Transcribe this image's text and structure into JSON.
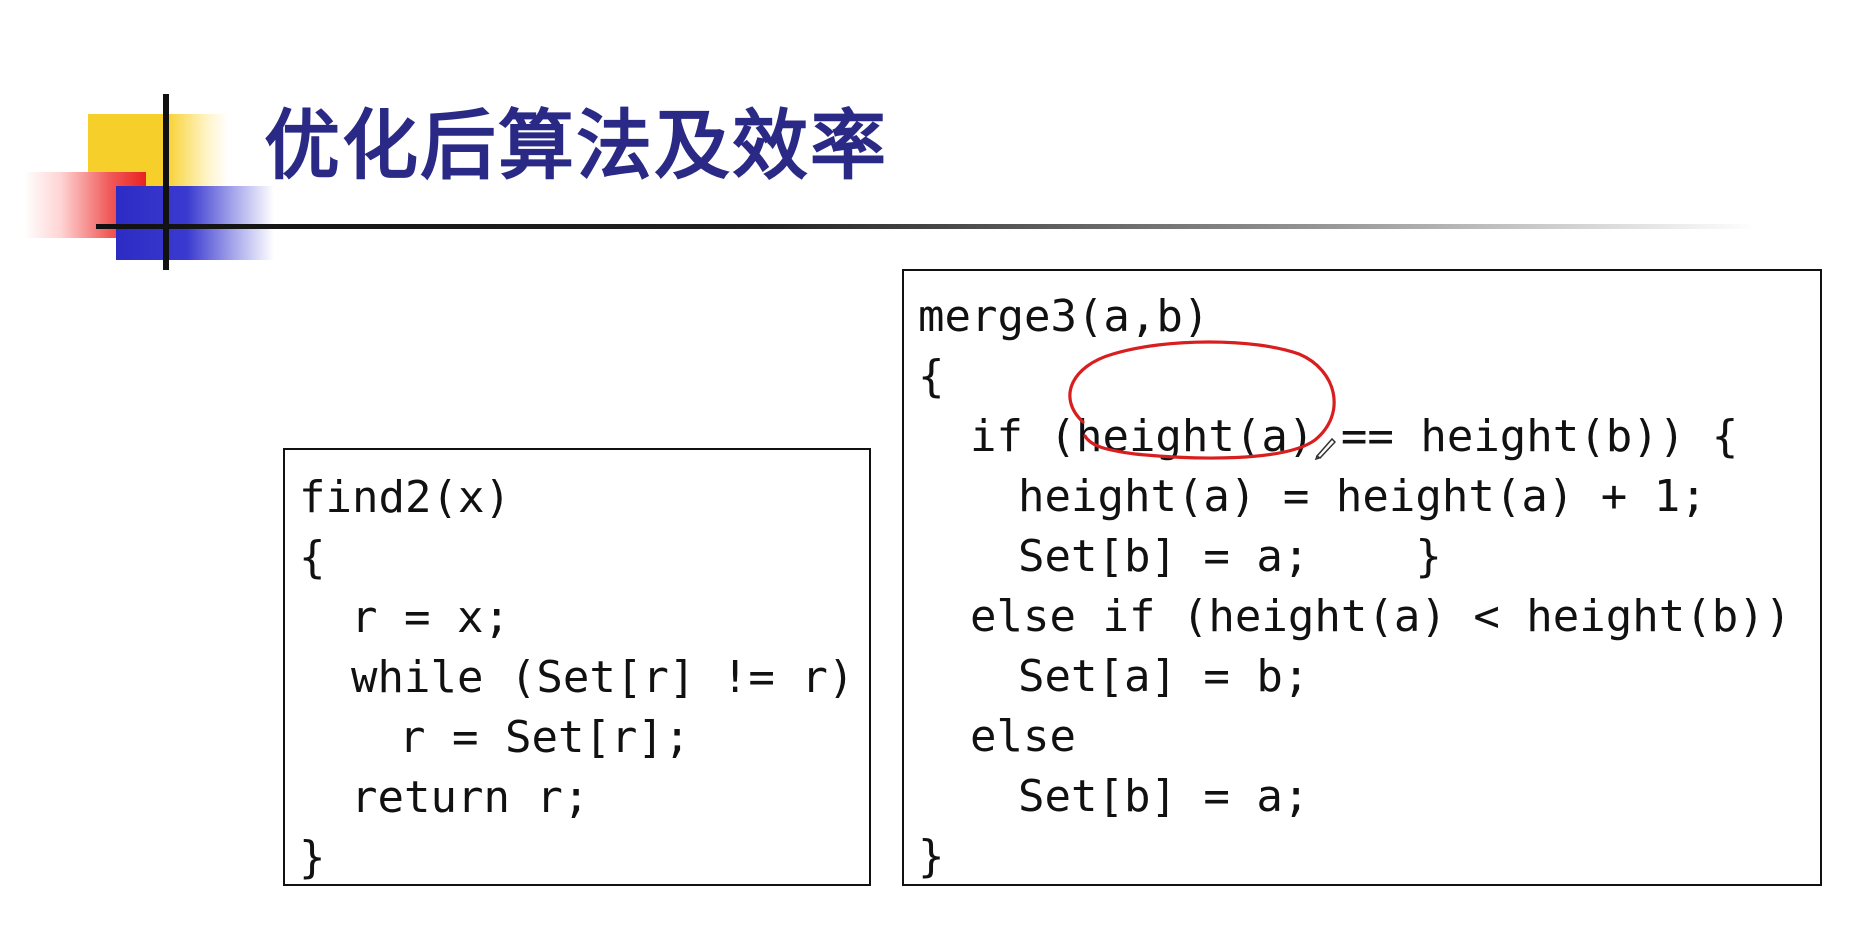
{
  "slide": {
    "title": "优化后算法及效率"
  },
  "find2": {
    "lines": [
      "find2(x)",
      "{",
      "r = x;",
      "while (Set[r] != r)",
      "r = Set[r];",
      "return r;",
      "}"
    ]
  },
  "merge3": {
    "lines": [
      "merge3(a,b)",
      "{",
      "if (height(a) == height(b)) {",
      "height(a) = height(a) + 1;",
      "Set[b] = a;    }",
      "else if (height(a) < height(b))",
      "Set[a] = b;",
      "else",
      "Set[b] = a;",
      "}"
    ]
  },
  "annotation": {
    "color": "#d81e1e",
    "target": "height(a)"
  },
  "icons": {
    "cursor": "pen-cursor-icon"
  },
  "colors": {
    "title": "#2a2a86",
    "deco_yellow": "#f7cf2a",
    "deco_red": "#e82222",
    "deco_blue": "#2c2cc4"
  }
}
